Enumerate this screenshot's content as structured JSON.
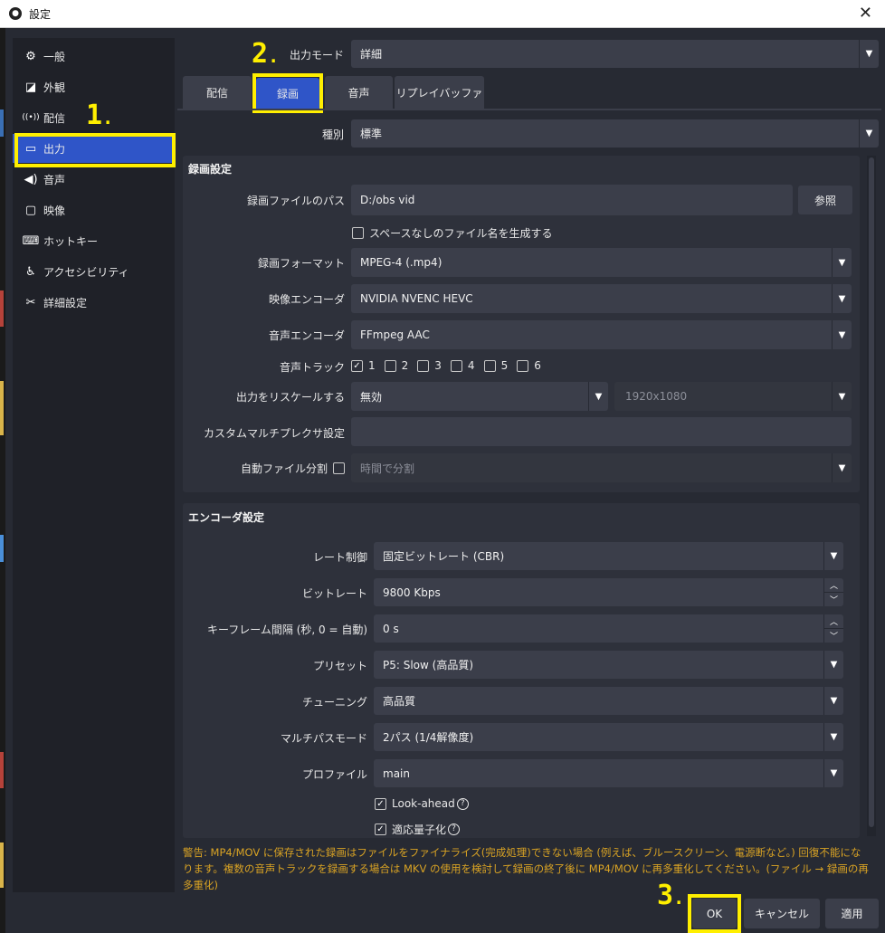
{
  "window": {
    "title": "設定",
    "close_glyph": "✕"
  },
  "sidebar": {
    "items": [
      {
        "label": "一般",
        "icon": "gear-icon",
        "glyph": "⚙"
      },
      {
        "label": "外観",
        "icon": "appearance-icon",
        "glyph": "◪"
      },
      {
        "label": "配信",
        "icon": "broadcast-icon",
        "glyph": "((•))"
      },
      {
        "label": "出力",
        "icon": "output-icon",
        "glyph": "▭"
      },
      {
        "label": "音声",
        "icon": "speaker-icon",
        "glyph": "🔊"
      },
      {
        "label": "映像",
        "icon": "monitor-icon",
        "glyph": "▢"
      },
      {
        "label": "ホットキー",
        "icon": "keyboard-icon",
        "glyph": "⌨"
      },
      {
        "label": "アクセシビリティ",
        "icon": "accessibility-icon",
        "glyph": "♿"
      },
      {
        "label": "詳細設定",
        "icon": "tools-icon",
        "glyph": "✂"
      }
    ],
    "active_index": 3
  },
  "markers": {
    "m1": "1",
    "m2": "2",
    "m3": "3",
    "dot": "."
  },
  "output_mode": {
    "label": "出力モード",
    "value": "詳細"
  },
  "tabs": [
    "配信",
    "録画",
    "音声",
    "リプレイバッファ"
  ],
  "active_tab": 1,
  "type": {
    "label": "種別",
    "value": "標準"
  },
  "recording": {
    "title": "録画設定",
    "path_label": "録画ファイルのパス",
    "path_value": "D:/obs vid",
    "browse": "参照",
    "nospace_label": "スペースなしのファイル名を生成する",
    "format_label": "録画フォーマット",
    "format_value": "MPEG-4 (.mp4)",
    "video_encoder_label": "映像エンコーダ",
    "video_encoder_value": "NVIDIA NVENC HEVC",
    "audio_encoder_label": "音声エンコーダ",
    "audio_encoder_value": "FFmpeg AAC",
    "tracks_label": "音声トラック",
    "tracks": [
      "1",
      "2",
      "3",
      "4",
      "5",
      "6"
    ],
    "tracks_checked": [
      true,
      false,
      false,
      false,
      false,
      false
    ],
    "rescale_label": "出力をリスケールする",
    "rescale_value": "無効",
    "rescale_res": "1920x1080",
    "muxer_label": "カスタムマルチプレクサ設定",
    "split_label": "自動ファイル分割",
    "split_value": "時間で分割"
  },
  "encoder": {
    "title": "エンコーダ設定",
    "rate_label": "レート制御",
    "rate_value": "固定ビットレート (CBR)",
    "bitrate_label": "ビットレート",
    "bitrate_value": "9800 Kbps",
    "keyframe_label": "キーフレーム間隔 (秒, 0 = 自動)",
    "keyframe_value": "0 s",
    "preset_label": "プリセット",
    "preset_value": "P5: Slow (高品質)",
    "tuning_label": "チューニング",
    "tuning_value": "高品質",
    "multipass_label": "マルチパスモード",
    "multipass_value": "2パス (1/4解像度)",
    "profile_label": "プロファイル",
    "profile_value": "main",
    "lookahead_label": "Look-ahead",
    "aq_label": "適応量子化"
  },
  "warning": "警告: MP4/MOV に保存された録画はファイルをファイナライズ(完成処理)できない場合 (例えば、ブルースクリーン、電源断など。) 回復不能になります。複数の音声トラックを録画する場合は MKV の使用を検討して録画の終了後に MP4/MOV に再多重化してください。(ファイル → 録画の再多重化)",
  "buttons": {
    "ok": "OK",
    "cancel": "キャンセル",
    "apply": "適用"
  },
  "glyphs": {
    "check": "✓",
    "dropdown": "▼",
    "up": "︿",
    "down": "﹀",
    "help": "?"
  },
  "colors": {
    "accent": "#2f55c8",
    "highlight": "#ffef00",
    "warning": "#d9a324"
  }
}
